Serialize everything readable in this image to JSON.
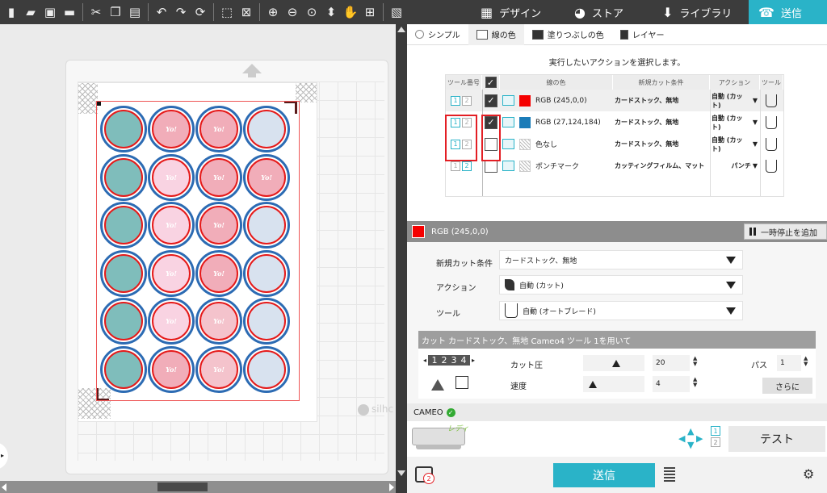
{
  "toolbar": {
    "icons": [
      "new-file-icon",
      "open-folder-icon",
      "save-icon",
      "print-icon",
      "cut-icon",
      "copy-icon",
      "paste-icon",
      "undo-icon",
      "redo-icon",
      "redraw-icon",
      "select-all-icon",
      "deselect-icon",
      "zoom-in-icon",
      "zoom-out-icon",
      "zoom-fit-icon",
      "drag-pan-icon",
      "hand-icon",
      "fit-page-icon"
    ],
    "nav": {
      "design": "デザイン",
      "store": "ストア",
      "library": "ライブラリ",
      "send": "送信"
    }
  },
  "canvas": {
    "watermark": "silhc",
    "stickers": [
      [
        "teal",
        "pink",
        "pink",
        "blue"
      ],
      [
        "teal",
        "plight",
        "pink",
        "pink"
      ],
      [
        "teal",
        "plight",
        "pink",
        "blue"
      ],
      [
        "teal",
        "plight",
        "pink",
        "blue"
      ],
      [
        "teal",
        "plight",
        "lpink",
        "blue"
      ],
      [
        "teal",
        "pink",
        "lpink",
        "blue"
      ]
    ],
    "sticker_texts": {
      "teal": "",
      "pink": "Yo!",
      "lpink": "Yo!",
      "plight": "Yo!",
      "blue": ""
    }
  },
  "panel": {
    "tabs": {
      "simple": "シンプル",
      "line_color": "線の色",
      "fill_color": "塗りつぶしの色",
      "layer": "レイヤー"
    },
    "action_title": "実行したいアクションを選択します。",
    "columns": {
      "tool_no": "ツール番号",
      "check": "",
      "line_color": "線の色",
      "cut_condition": "新規カット条件",
      "action": "アクション",
      "tool": "ツール"
    },
    "rows": [
      {
        "color_hex": "#f50000",
        "color_label": "RGB (245,0,0)",
        "checked": true,
        "condition": "カードストック、無地",
        "action": "自動 (カット)",
        "selected": true,
        "tool_active": 1
      },
      {
        "color_hex": "#1b7cb8",
        "color_label": "RGB (27,124,184)",
        "checked": true,
        "condition": "カードストック、無地",
        "action": "自動 (カット)",
        "selected": false,
        "tool_active": 1
      },
      {
        "color_hex": "none",
        "color_label": "色なし",
        "checked": false,
        "condition": "カードストック、無地",
        "action": "自動 (カット)",
        "selected": false,
        "tool_active": 1
      },
      {
        "color_hex": "none",
        "color_label": "ポンチマーク",
        "checked": false,
        "condition": "カッティングフィルム、マット",
        "action": "パンチ",
        "selected": false,
        "tool_active": 2
      }
    ],
    "layer_bar": {
      "swatch": "#f50000",
      "label": "RGB (245,0,0)",
      "pause_label": "一時停止を追加"
    },
    "props": {
      "condition_label": "新規カット条件",
      "condition_value": "カードストック、無地",
      "action_label": "アクション",
      "action_value": "自動 (カット)",
      "tool_label": "ツール",
      "tool_value": "自動 (オートブレード)"
    },
    "cut_info": "カット カードストック、無地 Cameo4 ツール 1を用いて",
    "cut_settings": {
      "pressure_label": "カット圧",
      "pressure_value": "20",
      "pressure_level": 0.55,
      "speed_label": "速度",
      "speed_value": "4",
      "speed_level": 0.1,
      "pass_label": "パス",
      "pass_value": "1",
      "more_label": "さらに",
      "depth_digits": [
        "1",
        "2",
        "3",
        "4"
      ]
    },
    "machine": {
      "name": "CAMEO",
      "status": "レディ",
      "test_label": "テスト",
      "slots": [
        "1",
        "2"
      ]
    },
    "send_label": "送信",
    "print_badge": "2"
  },
  "colors": {
    "accent": "#2ab3c8",
    "toolbar_bg": "#3c3c3c",
    "highlight": "#e31e24"
  }
}
